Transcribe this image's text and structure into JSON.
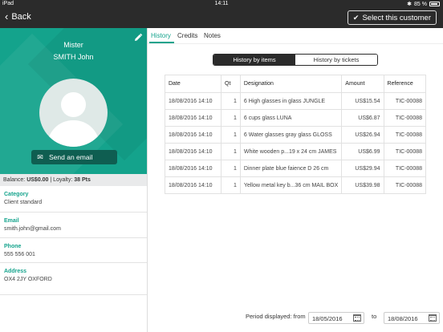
{
  "status": {
    "device": "iPad",
    "time": "14:11",
    "battery": "85 %"
  },
  "nav": {
    "back_label": "Back",
    "select_label": "Select this customer"
  },
  "customer": {
    "civility": "Mister",
    "name": "SMITH John",
    "email_button": "Send an email",
    "balance_label": "Balance:",
    "balance_value": "US$0.00",
    "loyalty_label": "| Loyalty:",
    "loyalty_value": "38 Pts",
    "category_label": "Category",
    "category_value": "Client standard",
    "email_label": "Email",
    "email_value": "smith.john@gmail.com",
    "phone_label": "Phone",
    "phone_value": "555 556 001",
    "address_label": "Address",
    "address_value": "OX4 2JY OXFORD"
  },
  "tabs": [
    {
      "label": "History"
    },
    {
      "label": "Credits"
    },
    {
      "label": "Notes"
    }
  ],
  "segment": {
    "items_label": "History by items",
    "tickets_label": "History by tickets"
  },
  "table": {
    "headers": [
      "Date",
      "Qt",
      "Designation",
      "Amount",
      "Reference"
    ],
    "rows": [
      [
        "18/08/2016 14:10",
        "1",
        "6 High glasses in glass JUNGLE",
        "US$15.54",
        "TIC-00088"
      ],
      [
        "18/08/2016 14:10",
        "1",
        "6 cups glass LUNA",
        "US$6.87",
        "TIC-00088"
      ],
      [
        "18/08/2016 14:10",
        "1",
        "6 Water glasses gray glass GLOSS",
        "US$26.94",
        "TIC-00088"
      ],
      [
        "18/08/2016 14:10",
        "1",
        "White wooden p...19 x 24 cm JAMES",
        "US$6.99",
        "TIC-00088"
      ],
      [
        "18/08/2016 14:10",
        "1",
        "Dinner plate blue faience D 26 cm",
        "US$29.94",
        "TIC-00088"
      ],
      [
        "18/08/2016 14:10",
        "1",
        "Yellow metal key b...36 cm MAIL BOX",
        "US$39.98",
        "TIC-00088"
      ]
    ]
  },
  "period": {
    "label": "Period displayed: from",
    "from": "18/05/2016",
    "to_label": "to",
    "to": "18/08/2016"
  },
  "colors": {
    "accent": "#14a38c",
    "dark": "#2b2b2b"
  }
}
